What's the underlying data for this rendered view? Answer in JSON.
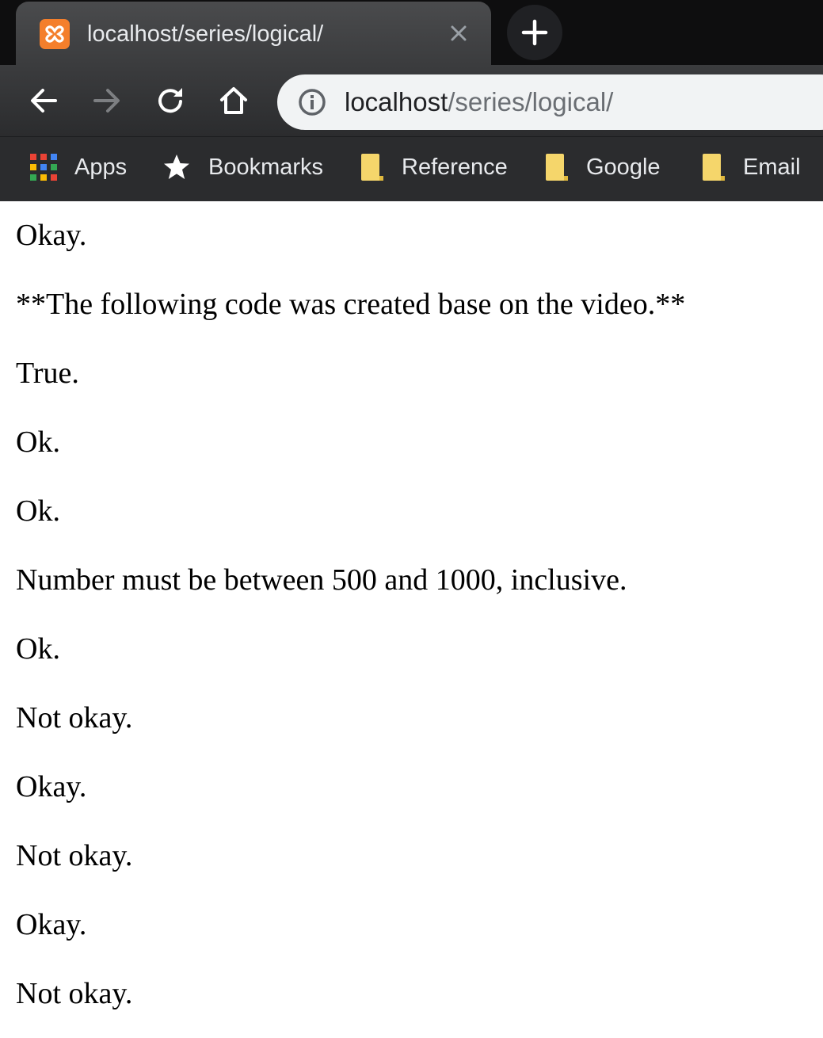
{
  "tab": {
    "title": "localhost/series/logical/",
    "favicon": "xampp-icon",
    "favicon_color": "#f47f2c"
  },
  "toolbar": {
    "back": "back-arrow-icon",
    "forward": "forward-arrow-icon",
    "reload": "reload-icon",
    "home": "home-icon"
  },
  "omnibox": {
    "host": "localhost",
    "path": "/series/logical/",
    "icon": "info-icon"
  },
  "bookmarks": [
    {
      "label": "Apps",
      "icon": "apps-grid-icon"
    },
    {
      "label": "Bookmarks",
      "icon": "star-icon"
    },
    {
      "label": "Reference",
      "icon": "folder-icon"
    },
    {
      "label": "Google",
      "icon": "folder-icon"
    },
    {
      "label": "Email",
      "icon": "folder-icon"
    }
  ],
  "page": {
    "lines": [
      "Okay.",
      "**The following code was created base on the video.**",
      "True.",
      "Ok.",
      "Ok.",
      "Number must be between 500 and 1000, inclusive.",
      "Ok.",
      "Not okay.",
      "Okay.",
      "Not okay.",
      "Okay.",
      "Not okay."
    ]
  },
  "colors": {
    "chrome_dark": "#202124",
    "folder": "#f5d66b",
    "text": "#000000"
  }
}
